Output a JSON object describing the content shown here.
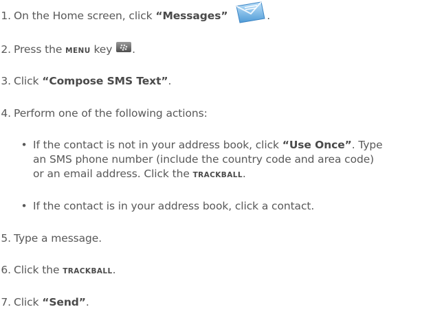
{
  "steps": [
    {
      "num": "1.",
      "pre": "On the Home screen, click ",
      "bold": "“Messages”",
      "post": ".",
      "icon": "messages-envelope-icon"
    },
    {
      "num": "2.",
      "pre": "Press the ",
      "key": "MENU",
      "mid": " key ",
      "post": ".",
      "icon": "blackberry-menu-key-icon"
    },
    {
      "num": "3.",
      "pre": "Click ",
      "bold": "“Compose SMS Text”",
      "post": "."
    },
    {
      "num": "4.",
      "pre": "Perform one of the following actions:"
    },
    {
      "num": "5.",
      "pre": "Type a message."
    },
    {
      "num": "6.",
      "pre": "Click the ",
      "key": "TRACKBALL",
      "post": "."
    },
    {
      "num": "7.",
      "pre": "Click ",
      "bold": "“Send”",
      "post": "."
    }
  ],
  "bullets": [
    {
      "l1_pre": "If the contact is not in your address book, click ",
      "l1_bold": "“Use Once”",
      "l1_post": ". Type",
      "l2": "an SMS phone number (include the country code and area code)",
      "l3_pre": "or an email address. Click the ",
      "l3_key": "TRACKBALL",
      "l3_post": "."
    },
    {
      "l1": "If the contact is in your address book, click a contact."
    }
  ],
  "bullet_glyph": "•",
  "colors": {
    "text": "#585858",
    "icon_envelope": "#6aaee0",
    "icon_key": "#6f6f6f"
  }
}
